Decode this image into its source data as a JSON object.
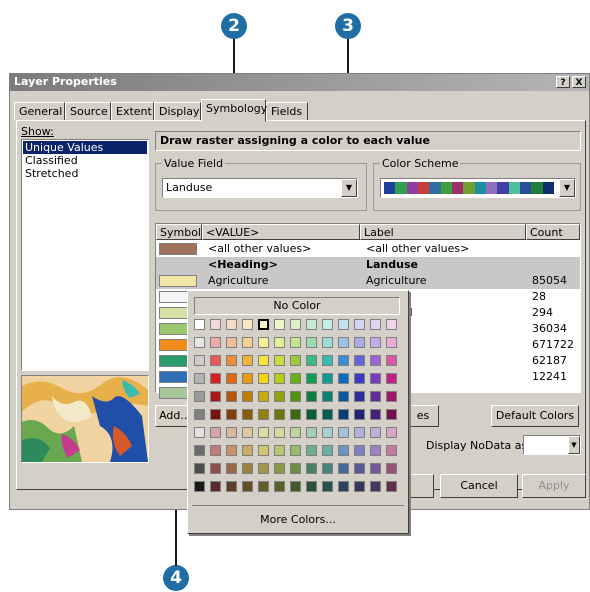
{
  "callouts": [
    "2",
    "3",
    "4"
  ],
  "window": {
    "title": "Layer Properties",
    "help_label": "?",
    "close_label": "X"
  },
  "tabs": [
    {
      "label": "General"
    },
    {
      "label": "Source"
    },
    {
      "label": "Extent"
    },
    {
      "label": "Display"
    },
    {
      "label": "Symbology"
    },
    {
      "label": "Fields"
    }
  ],
  "show": {
    "label": "Show:",
    "items": [
      "Unique Values",
      "Classified",
      "Stretched"
    ],
    "selected_index": 0
  },
  "header_text": "Draw raster assigning a color to each value",
  "value_field": {
    "label": "Value Field",
    "value": "Landuse"
  },
  "color_scheme": {
    "label": "Color Scheme",
    "colors": [
      "#1f3f9f",
      "#2f9f4f",
      "#8f3f9f",
      "#c83f3f",
      "#2f6f9f",
      "#3f9f3f",
      "#9f2f6f",
      "#6f9f2f",
      "#1f8f9f",
      "#8f6fbf",
      "#3f3fa6",
      "#4fbf9f",
      "#2a4d9a",
      "#1f7f3f",
      "#0f2f6f"
    ]
  },
  "table": {
    "columns": [
      "Symbol",
      "<VALUE>",
      "Label",
      "Count"
    ],
    "rows": [
      {
        "swatch": "#a0705a",
        "value": "<all other values>",
        "label": "<all other values>",
        "count": ""
      },
      {
        "swatch": "",
        "value": "<Heading>",
        "label": "Landuse",
        "count": ""
      },
      {
        "swatch": "#f2e6a6",
        "value": "Agriculture",
        "label": "Agriculture",
        "count": "85054"
      },
      {
        "swatch": "#f5f5f5",
        "value": "",
        "label": "nd",
        "count": "28"
      },
      {
        "swatch": "#d6e2a4",
        "value": "",
        "label": "nsitional",
        "count": "294"
      },
      {
        "swatch": "#9bc86e",
        "value": "",
        "label": "",
        "count": "36034"
      },
      {
        "swatch": "#f08c1e",
        "value": "",
        "label": "",
        "count": "671722"
      },
      {
        "swatch": "#2a9a6a",
        "value": "",
        "label": "",
        "count": "62187"
      },
      {
        "swatch": "#2f6db5",
        "value": "",
        "label": "",
        "count": "12241"
      },
      {
        "swatch": "#a8c89a",
        "value": "",
        "label": "",
        "count": ""
      }
    ]
  },
  "buttons": {
    "add": "Add...",
    "values_partial": "es",
    "default_colors": "Default Colors",
    "display_nodata_label": "Display NoData as",
    "ok_partial": "",
    "cancel": "Cancel",
    "apply": "Apply"
  },
  "palette": {
    "no_color": "No Color",
    "more_colors": "More Colors...",
    "grid": [
      [
        "#ffffff",
        "#f2d9d9",
        "#f6dcc6",
        "#f9e6c2",
        "#fbf5c6",
        "#eef5c6",
        "#dcefc6",
        "#c6ecd0",
        "#c6ecea",
        "#c6dff3",
        "#d3d3f3",
        "#e0d3f3",
        "#f3d3ea"
      ],
      [
        "#e6e6e6",
        "#eeaaaa",
        "#f0bf9a",
        "#f6d290",
        "#f8ee96",
        "#e0ee96",
        "#c4e48f",
        "#98dcb0",
        "#99dcd8",
        "#9ac3ea",
        "#ababea",
        "#c5abea",
        "#eaaad5"
      ],
      [
        "#cccccc",
        "#e55a5a",
        "#eb8f3c",
        "#f2b33a",
        "#f7e33c",
        "#ccdc3c",
        "#9ccc3c",
        "#3cba7c",
        "#3cbab0",
        "#3c8fd6",
        "#6565d6",
        "#9c65d6",
        "#d65aa6"
      ],
      [
        "#b3b3b3",
        "#d42020",
        "#e06a10",
        "#eb9a10",
        "#f4d412",
        "#b5cc10",
        "#6ab012",
        "#0f9b55",
        "#0f9b8f",
        "#0f6ac2",
        "#3a3ac2",
        "#7a3ac2",
        "#c22085"
      ],
      [
        "#9a9a9a",
        "#a81818",
        "#b5560c",
        "#bf7d0c",
        "#c7ab0e",
        "#91a30c",
        "#55900e",
        "#0c7e45",
        "#0c7e73",
        "#0c569e",
        "#2e2e9e",
        "#622e9e",
        "#9e186b"
      ],
      [
        "#808080",
        "#7a1212",
        "#843f09",
        "#8c5b09",
        "#92800b",
        "#6a7709",
        "#3e6a0b",
        "#095c33",
        "#095c54",
        "#093f74",
        "#222274",
        "#482274",
        "#74124f"
      ],
      [
        "#e0e0e0",
        "#d6a6a6",
        "#d9b8a0",
        "#dcc89c",
        "#dedaa0",
        "#d2daa0",
        "#c0d4a0",
        "#a4cfb4",
        "#a4cfcc",
        "#a4bfd9",
        "#b0b0d9",
        "#c0b0d9",
        "#d9a6c6"
      ],
      [
        "#6b6b6b",
        "#c07a7a",
        "#c7936f",
        "#ccaa68",
        "#d0c66e",
        "#b8c66e",
        "#98ba6e",
        "#6eae88",
        "#6eaea8",
        "#6e93c2",
        "#8080c2",
        "#a080c2",
        "#c27aa2"
      ],
      [
        "#4d4d4d",
        "#8f4f4f",
        "#96684a",
        "#9c7f44",
        "#a09848",
        "#8a9848",
        "#6c8c48",
        "#488360",
        "#48837e",
        "#486898",
        "#585898",
        "#745898",
        "#985276"
      ],
      [
        "#1a1a1a",
        "#5c2a2a",
        "#5f3f2a",
        "#63502a",
        "#665f2c",
        "#58602c",
        "#445a2c",
        "#2c523c",
        "#2c524f",
        "#2c415f",
        "#36365f",
        "#46365f",
        "#5f2c4b"
      ]
    ]
  }
}
